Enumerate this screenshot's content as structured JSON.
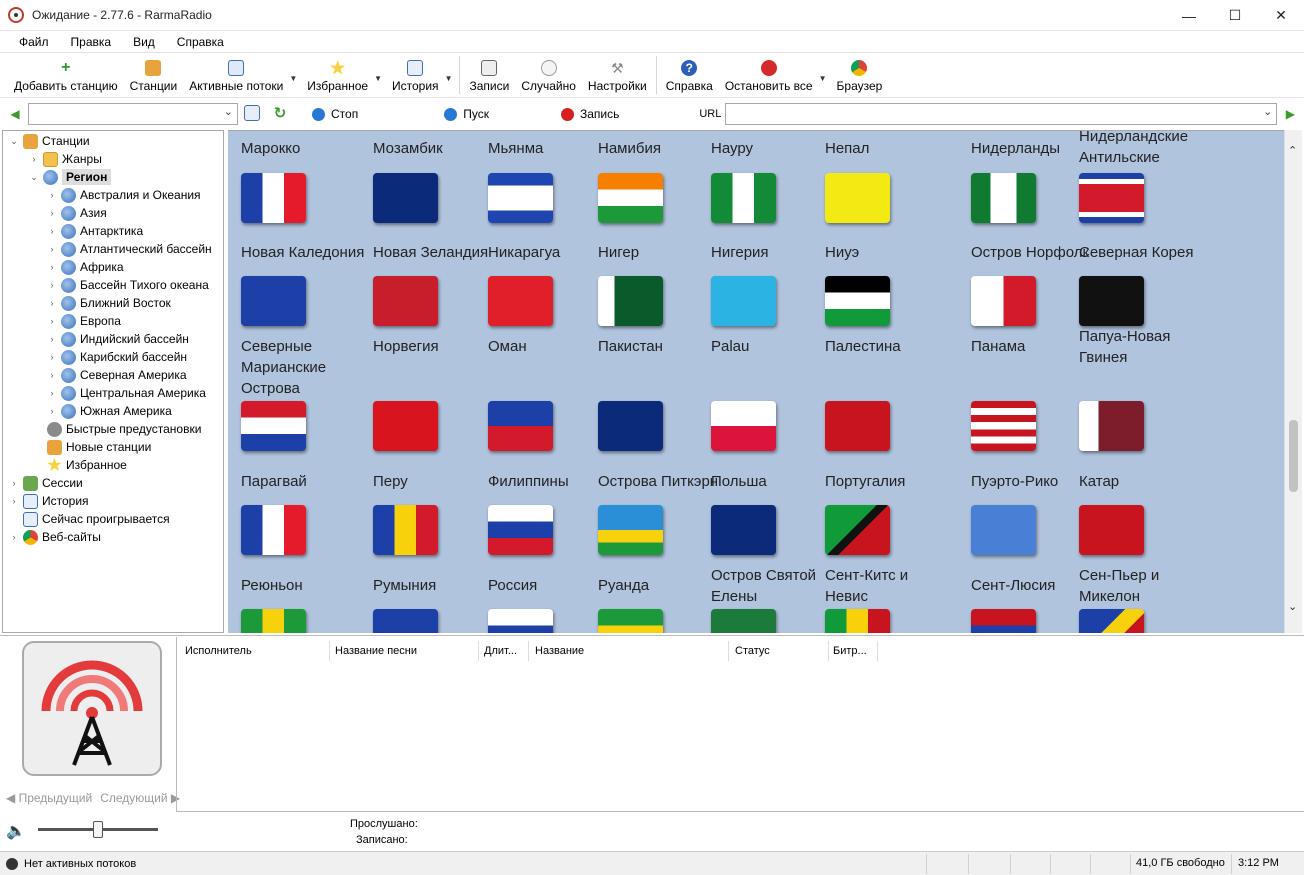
{
  "window": {
    "title": "Ожидание - 2.77.6 - RarmaRadio"
  },
  "menu": [
    "Файл",
    "Правка",
    "Вид",
    "Справка"
  ],
  "toolbar": {
    "add_station": "Добавить станцию",
    "stations": "Станции",
    "active_streams": "Активные потоки",
    "favorites": "Избранное",
    "history": "История",
    "records": "Записи",
    "random": "Случайно",
    "settings": "Настройки",
    "help": "Справка",
    "stop_all": "Остановить все",
    "browser": "Браузер"
  },
  "addressbar": {
    "station_value": "",
    "stop": "Стоп",
    "play": "Пуск",
    "record": "Запись",
    "url_label": "URL",
    "url_value": ""
  },
  "tree": {
    "stations": "Станции",
    "genres": "Жанры",
    "region": "Регион",
    "regions": [
      "Австралия и Океания",
      "Азия",
      "Антарктика",
      "Атлантический бассейн",
      "Африка",
      "Бассейн Тихого океана",
      "Ближний Восток",
      "Европа",
      "Индийский бассейн",
      "Карибский бассейн",
      "Северная Америка",
      "Центральная Америка",
      "Южная Америка"
    ],
    "quick_presets": "Быстрые предустановки",
    "new_stations": "Новые станции",
    "favorites": "Избранное",
    "sessions": "Сессии",
    "history": "История",
    "now_playing": "Сейчас проигрывается",
    "websites": "Веб-сайты"
  },
  "grid": {
    "rows": [
      [
        "Марокко",
        "Мозамбик",
        "Мьянма",
        "Намибия",
        "Науру",
        "Непал",
        "Нидерланды",
        "Нидерландские Антильские Острова"
      ],
      [
        "Новая Каледония",
        "Новая Зеландия",
        "Никарагуа",
        "Нигер",
        "Нигерия",
        "Ниуэ",
        "Остров Норфолк",
        "Северная Корея"
      ],
      [
        "Северные Марианские Острова",
        "Норвегия",
        "Оман",
        "Пакистан",
        "Palau",
        "Палестина",
        "Панама",
        "Папуа-Новая Гвинея"
      ],
      [
        "Парагвай",
        "Перу",
        "Филиппины",
        "Острова Питкэрн",
        "Польша",
        "Португалия",
        "Пуэрто-Рико",
        "Катар"
      ],
      [
        "Реюньон",
        "Румыния",
        "Россия",
        "Руанда",
        "Остров Святой Елены",
        "Сент-Китс и Невис",
        "Сент-Люсия",
        "Сен-Пьер и Микелон"
      ]
    ]
  },
  "tracklist": {
    "columns": [
      "Исполнитель",
      "Название песни",
      "Длит...",
      "Название",
      "Статус",
      "Битр..."
    ]
  },
  "player": {
    "prev": "Предыдущий",
    "next": "Следующий",
    "listened_label": "Прослушано:",
    "recorded_label": "Записано:"
  },
  "status": {
    "streams": "Нет активных потоков",
    "disk_free": "41,0 ГБ свободно",
    "time": "3:12 PM"
  }
}
